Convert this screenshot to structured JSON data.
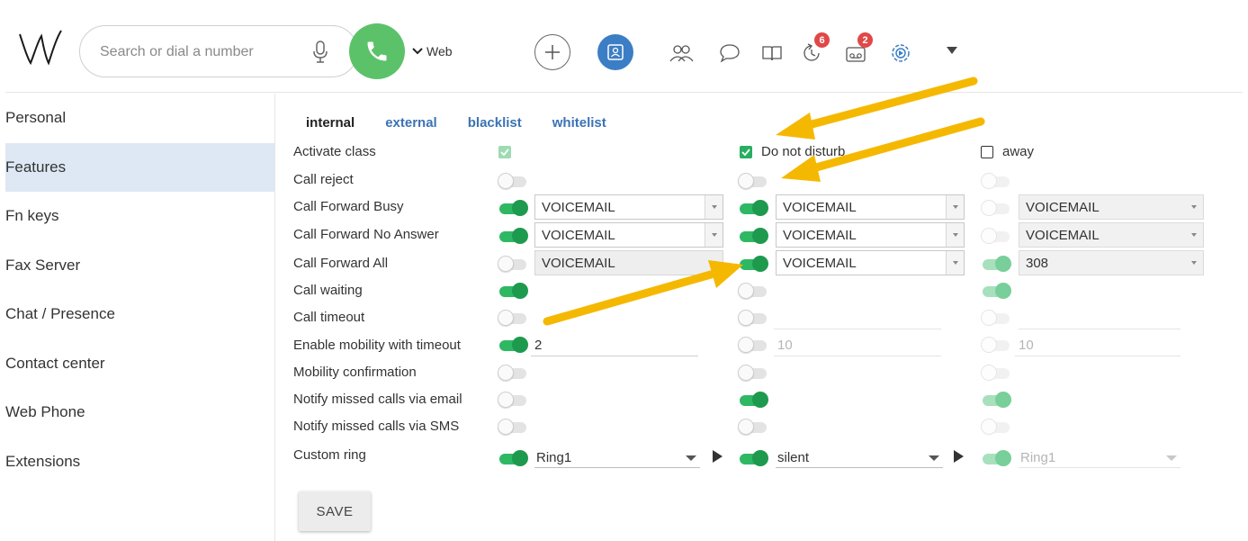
{
  "header": {
    "search_placeholder": "Search or dial a number",
    "web_label": "Web",
    "badges": {
      "history": "6",
      "voicemail": "2"
    }
  },
  "sidebar": {
    "items": [
      {
        "label": "Personal",
        "active": false
      },
      {
        "label": "Features",
        "active": true
      },
      {
        "label": "Fn keys",
        "active": false
      },
      {
        "label": "Fax Server",
        "active": false
      },
      {
        "label": "Chat / Presence",
        "active": false
      },
      {
        "label": "Contact center",
        "active": false
      },
      {
        "label": "Web Phone",
        "active": false
      },
      {
        "label": "Extensions",
        "active": false
      }
    ]
  },
  "tabs": [
    {
      "label": "internal",
      "active": true
    },
    {
      "label": "external",
      "active": false
    },
    {
      "label": "blacklist",
      "active": false
    },
    {
      "label": "whitelist",
      "active": false
    }
  ],
  "columns": {
    "col1": {
      "label": "",
      "checked": true
    },
    "col2": {
      "label": "Do not disturb",
      "checked": true
    },
    "col3": {
      "label": "away",
      "checked": false
    }
  },
  "rows": {
    "activate_class": "Activate class",
    "call_reject": "Call reject",
    "call_forward_busy": "Call Forward Busy",
    "call_forward_no_answer": "Call Forward No Answer",
    "call_forward_all": "Call Forward All",
    "call_waiting": "Call waiting",
    "call_timeout": "Call timeout",
    "enable_mobility": "Enable mobility with timeout",
    "mobility_confirmation": "Mobility confirmation",
    "notify_email": "Notify missed calls via email",
    "notify_sms": "Notify missed calls via SMS",
    "custom_ring": "Custom ring"
  },
  "values": {
    "col1": {
      "forward_busy": "VOICEMAIL",
      "forward_no_answer": "VOICEMAIL",
      "forward_all": "VOICEMAIL",
      "mobility_timeout": "2",
      "ring": "Ring1"
    },
    "col2": {
      "forward_busy": "VOICEMAIL",
      "forward_no_answer": "VOICEMAIL",
      "forward_all": "VOICEMAIL",
      "mobility_timeout": "10",
      "ring": "silent"
    },
    "col3": {
      "forward_busy": "VOICEMAIL",
      "forward_no_answer": "VOICEMAIL",
      "forward_all": "308",
      "mobility_timeout": "10",
      "ring": "Ring1"
    }
  },
  "save_label": "SAVE",
  "colors": {
    "accent_green": "#27ae60",
    "link_blue": "#3b73b5",
    "sidebar_active": "#dde8f4",
    "call_button": "#5cc26a",
    "annotation_arrow": "#f5b800"
  }
}
